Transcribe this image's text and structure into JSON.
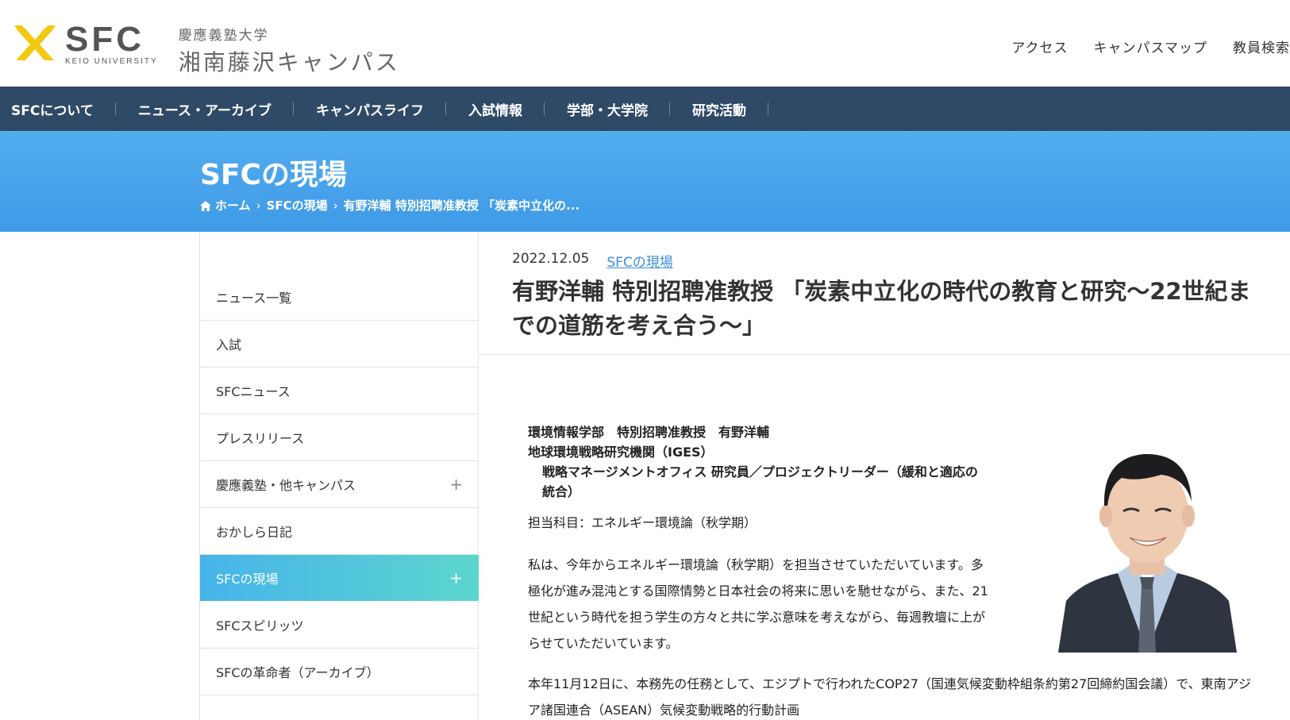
{
  "header": {
    "logo_text": "SFC",
    "logo_sub": "KEIO UNIVERSITY",
    "univ_name": "慶應義塾大学",
    "campus_name": "湘南藤沢キャンパス",
    "util_links": [
      "アクセス",
      "キャンパスマップ",
      "教員検索"
    ]
  },
  "gnav": [
    "SFCについて",
    "ニュース・アーカイブ",
    "キャンパスライフ",
    "入試情報",
    "学部・大学院",
    "研究活動"
  ],
  "hero": {
    "title": "SFCの現場",
    "breadcrumb": [
      "ホーム",
      "SFCの現場",
      "有野洋輔 特別招聘准教授 「炭素中立化の..."
    ]
  },
  "sidebar": {
    "items": [
      {
        "label": "ニュース一覧",
        "expandable": false,
        "active": false
      },
      {
        "label": "入試",
        "expandable": false,
        "active": false
      },
      {
        "label": "SFCニュース",
        "expandable": false,
        "active": false
      },
      {
        "label": "プレスリリース",
        "expandable": false,
        "active": false
      },
      {
        "label": "慶應義塾・他キャンパス",
        "expandable": true,
        "active": false
      },
      {
        "label": "おかしら日記",
        "expandable": false,
        "active": false
      },
      {
        "label": "SFCの現場",
        "expandable": true,
        "active": true
      },
      {
        "label": "SFCスピリッツ",
        "expandable": false,
        "active": false
      },
      {
        "label": "SFCの革命者（アーカイブ）",
        "expandable": false,
        "active": false
      }
    ],
    "plus_symbol": "+"
  },
  "article": {
    "date": "2022.12.05",
    "category": "SFCの現場",
    "title": "有野洋輔 特別招聘准教授 「炭素中立化の時代の教育と研究～22世紀までの道筋を考え合う～」",
    "profile_line1": "環境情報学部　特別招聘准教授　有野洋輔",
    "profile_line2": "地球環境戦略研究機関（IGES）",
    "profile_line3": "戦略マネージメントオフィス 研究員／プロジェクトリーダー（緩和と適応の統合）",
    "subject": "担当科目：エネルギー環境論（秋学期）",
    "para1": "私は、今年からエネルギー環境論（秋学期）を担当させていただいています。多極化が進み混沌とする国際情勢と日本社会の将来に思いを馳せながら、また、21世紀という時代を担う学生の方々と共に学ぶ意味を考えながら、毎週教壇に上がらせていただいています。",
    "para2": "本年11月12日に、本務先の任務として、エジプトで行われたCOP27（国連気候変動枠組条約第27回締約国会議）で、東南アジア諸国連合（ASEAN）気候変動戦略的行動計画"
  },
  "colors": {
    "nav_bg": "#2f4a66",
    "hero_blue": "#4aa6ec",
    "active_gradient_start": "#46b4ea",
    "active_gradient_end": "#5cd6cf",
    "logo_yellow": "#f2c811",
    "link_blue": "#3d8fdc"
  }
}
